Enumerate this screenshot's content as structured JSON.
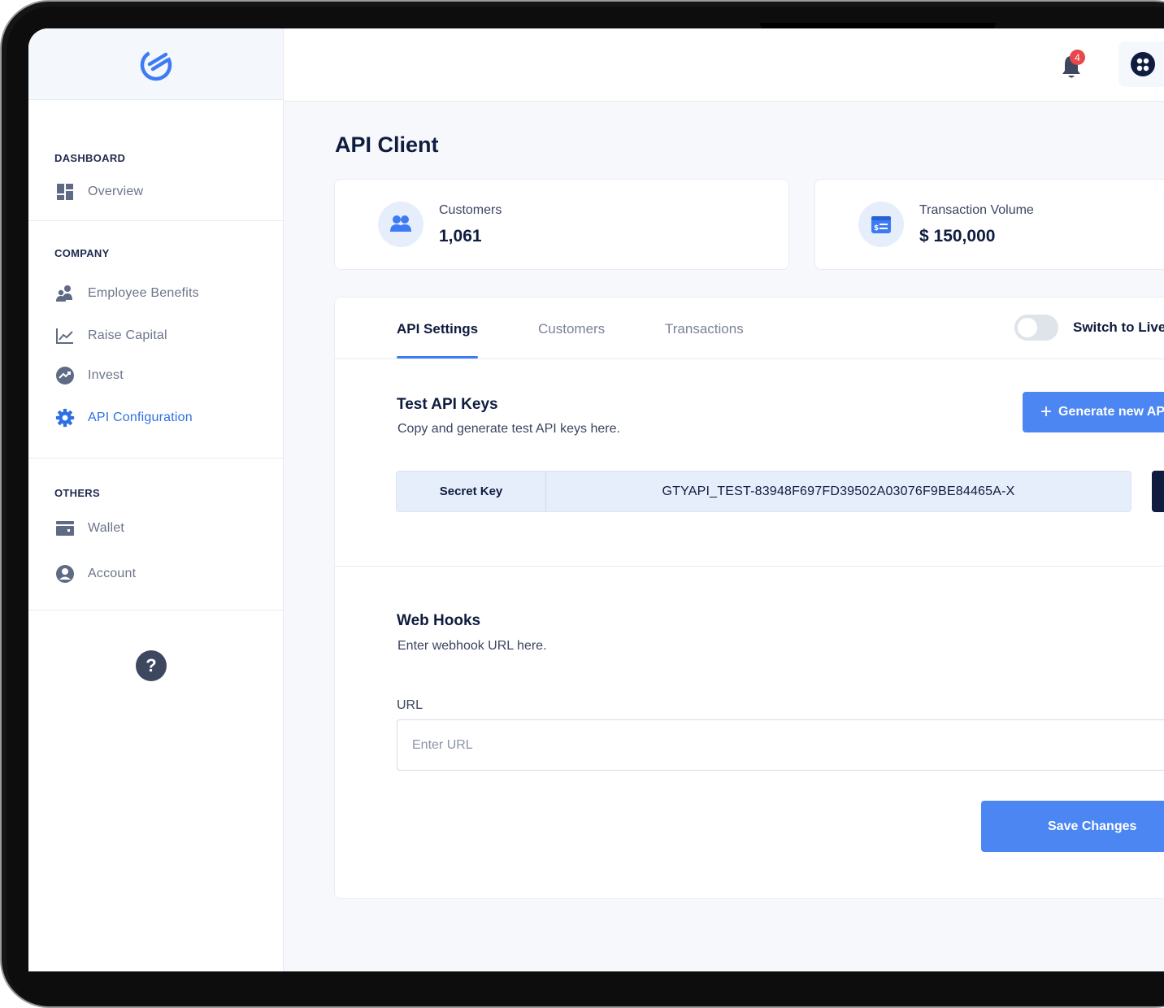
{
  "sidebar": {
    "sections": [
      {
        "title": "DASHBOARD",
        "items": [
          {
            "label": "Overview",
            "icon": "dashboard-grid-icon"
          }
        ]
      },
      {
        "title": "COMPANY",
        "items": [
          {
            "label": "Employee Benefits",
            "icon": "people-icon"
          },
          {
            "label": "Raise Capital",
            "icon": "line-chart-icon"
          },
          {
            "label": "Invest",
            "icon": "trending-up-icon"
          },
          {
            "label": "API Configuration",
            "icon": "gear-icon",
            "active": true
          }
        ]
      },
      {
        "title": "OTHERS",
        "items": [
          {
            "label": "Wallet",
            "icon": "wallet-icon"
          },
          {
            "label": "Account",
            "icon": "user-circle-icon"
          }
        ]
      }
    ],
    "help_label": "?"
  },
  "topbar": {
    "notification_count": "4"
  },
  "page": {
    "title": "API Client"
  },
  "stats": [
    {
      "label": "Customers",
      "value": "1,061",
      "icon": "users-icon"
    },
    {
      "label": "Transaction Volume",
      "value": "$ 150,000",
      "icon": "receipt-icon"
    }
  ],
  "tabs": [
    {
      "label": "API Settings",
      "active": true
    },
    {
      "label": "Customers"
    },
    {
      "label": "Transactions"
    }
  ],
  "toggle": {
    "label": "Switch to Live",
    "on": false
  },
  "test_keys": {
    "title": "Test API Keys",
    "subtitle": "Copy and generate test API keys here.",
    "generate_label": "Generate new API",
    "secret_label": "Secret Key",
    "secret_value": "GTYAPI_TEST-83948F697FD39502A03076F9BE84465A-X"
  },
  "webhooks": {
    "title": "Web Hooks",
    "subtitle": "Enter webhook URL here.",
    "url_label": "URL",
    "url_placeholder": "Enter URL",
    "save_label": "Save Changes"
  },
  "colors": {
    "accent": "#4b86f2",
    "navy": "#0f1c3f",
    "alert": "#e8484b"
  }
}
